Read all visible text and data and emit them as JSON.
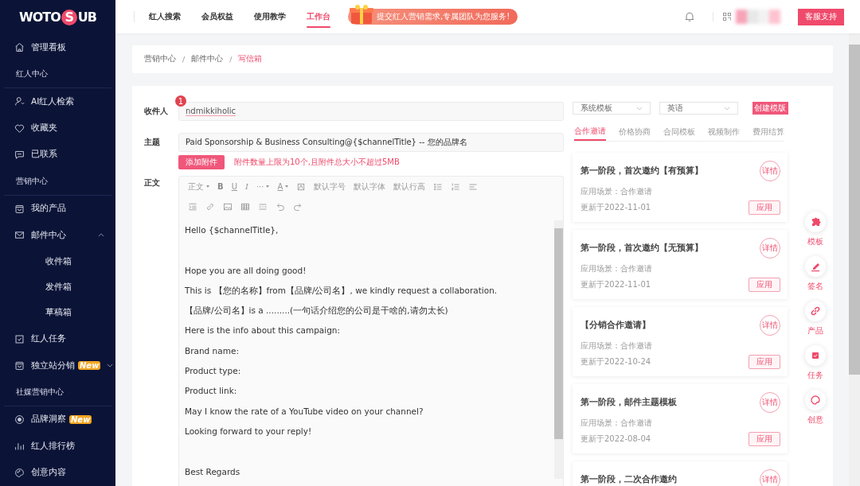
{
  "logo": {
    "left": "WOTO",
    "mark": "S",
    "right": "UB"
  },
  "sidebar": [
    {
      "kind": "item",
      "label": "管理看板"
    },
    {
      "kind": "section",
      "label": "红人中心"
    },
    {
      "kind": "item",
      "label": "AI红人检索"
    },
    {
      "kind": "item",
      "label": "收藏夹"
    },
    {
      "kind": "item",
      "label": "已联系"
    },
    {
      "kind": "section",
      "label": "营销中心"
    },
    {
      "kind": "item",
      "label": "我的产品"
    },
    {
      "kind": "group",
      "label": "邮件中心",
      "expanded": true,
      "children": [
        {
          "label": "收件箱"
        },
        {
          "label": "发件箱"
        },
        {
          "label": "草稿箱"
        }
      ]
    },
    {
      "kind": "item",
      "label": "红人任务"
    },
    {
      "kind": "group",
      "label": "独立站分销",
      "badge": "New",
      "expanded": false
    },
    {
      "kind": "section",
      "label": "社媒营销中心"
    },
    {
      "kind": "item",
      "label": "品牌洞察",
      "badge": "New"
    },
    {
      "kind": "item",
      "label": "红人排行榜"
    },
    {
      "kind": "item",
      "label": "创意内容"
    }
  ],
  "top_nav": [
    {
      "label": "红人搜索",
      "selected": false
    },
    {
      "label": "会员权益",
      "selected": false
    },
    {
      "label": "使用教学",
      "selected": false
    },
    {
      "label": "工作台",
      "selected": true
    }
  ],
  "banner": "提交红人营销需求,专属团队为您服务!",
  "support_button": "客服支持",
  "breadcrumb": [
    {
      "label": "营销中心",
      "current": false
    },
    {
      "label": "邮件中心",
      "current": false
    },
    {
      "label": "写信箱",
      "current": true
    }
  ],
  "breadcrumb_separator": "/",
  "form": {
    "recipient_label": "收件人",
    "recipient_count": "1",
    "recipient": "ndmikkiholic",
    "subject_label": "主题",
    "subject": "Paid Sponsorship & Business Consulting@{$channelTitle} -- 您的品牌名",
    "attach_button": "添加附件",
    "attach_hint": "附件数量上限为10个,且附件总大小不超过5MB",
    "body_label": "正文"
  },
  "toolbar": {
    "format": "正文",
    "bold": "B",
    "underline": "U",
    "italic": "I",
    "more": "···",
    "font_color": "A",
    "font_size": "默认字号",
    "font_family": "默认字体",
    "line_height": "默认行高"
  },
  "body_lines": [
    {
      "kind": "text",
      "text": "Hello {$channelTitle},"
    },
    {
      "kind": "blank"
    },
    {
      "kind": "text",
      "text": "Hope you are all doing good!"
    },
    {
      "kind": "text",
      "text": "This is 【您的名称】from【品牌/公司名】, we kindly request a collaboration."
    },
    {
      "kind": "text",
      "text": "【品牌/公司名】is a .........(一句话介绍您的公司是干啥的,请勿太长)"
    },
    {
      "kind": "text",
      "text": "Here is the info about this campaign:"
    },
    {
      "kind": "text",
      "text": "Brand name:"
    },
    {
      "kind": "text",
      "text": "Product type:"
    },
    {
      "kind": "text",
      "text": "Product link:"
    },
    {
      "kind": "text",
      "text": "May I know the rate of a YouTube video on your channel?"
    },
    {
      "kind": "text",
      "text": "Looking forward to your reply!"
    },
    {
      "kind": "blank"
    },
    {
      "kind": "text",
      "text": "Best Regards"
    }
  ],
  "template_source": "系统模板",
  "language": "英语",
  "create_button": "创建模版",
  "template_tabs": [
    {
      "label": "合作邀请",
      "selected": true
    },
    {
      "label": "价格协商",
      "selected": false
    },
    {
      "label": "合同模板",
      "selected": false
    },
    {
      "label": "视频制作",
      "selected": false
    },
    {
      "label": "费用结算",
      "selected": false
    }
  ],
  "templates": [
    {
      "title": "第一阶段，首次邀约【有预算】",
      "detail": "详情",
      "scene": "应用场景：合作邀请",
      "updated": "更新于2022-11-01",
      "apply": "应用"
    },
    {
      "title": "第一阶段，首次邀约【无预算】",
      "detail": "详情",
      "scene": "应用场景：合作邀请",
      "updated": "更新于2022-11-01",
      "apply": "应用"
    },
    {
      "title": "【分销合作邀请】",
      "detail": "详情",
      "scene": "应用场景：合作邀请",
      "updated": "更新于2022-10-24",
      "apply": "应用"
    },
    {
      "title": "第一阶段，邮件主题模板",
      "detail": "详情",
      "scene": "应用场景：合作邀请",
      "updated": "更新于2022-08-04",
      "apply": "应用"
    },
    {
      "title": "第一阶段，二次合作邀约",
      "detail": "详情"
    }
  ],
  "tools": [
    {
      "label": "模板"
    },
    {
      "label": "签名"
    },
    {
      "label": "产品"
    },
    {
      "label": "任务"
    },
    {
      "label": "创意"
    }
  ]
}
